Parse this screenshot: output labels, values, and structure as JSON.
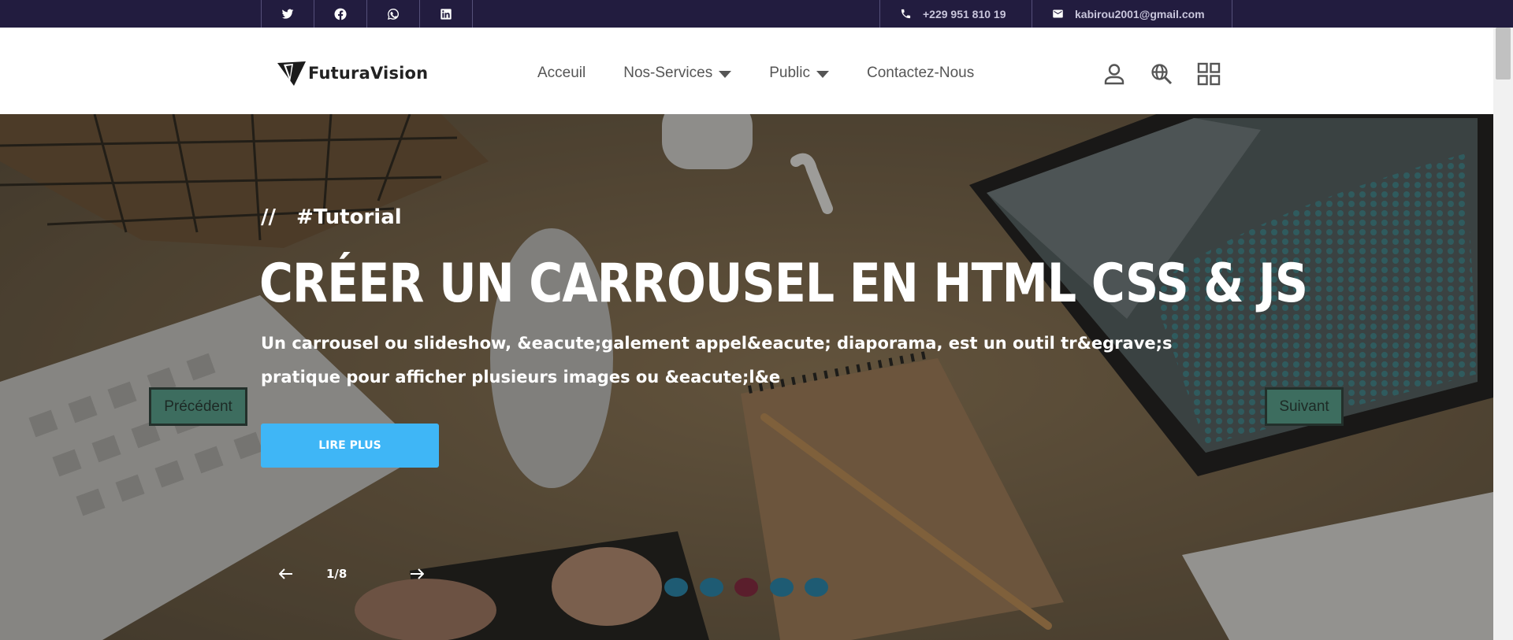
{
  "topbar": {
    "socials": [
      {
        "icon": "twitter-icon"
      },
      {
        "icon": "facebook-icon"
      },
      {
        "icon": "whatsapp-icon"
      },
      {
        "icon": "linkedin-icon"
      }
    ],
    "phone": "+229 951 810 19",
    "email": "kabirou2001@gmail.com"
  },
  "header": {
    "brand": "FuturaVision",
    "nav": [
      {
        "label": "Acceuil",
        "dropdown": false
      },
      {
        "label": "Nos-Services",
        "dropdown": true
      },
      {
        "label": "Public",
        "dropdown": true
      },
      {
        "label": "Contactez-Nous",
        "dropdown": false
      }
    ],
    "icons": [
      "user-icon",
      "search-globe-icon",
      "grid-menu-icon"
    ]
  },
  "hero": {
    "slashes": "//",
    "tag": "#Tutorial",
    "title": "CRÉER UN CARROUSEL EN HTML CSS & JS",
    "description": "Un carrousel ou slideshow, &eacute;galement appel&eacute; diaporama, est un outil tr&egrave;s pratique pour afficher plusieurs images ou &eacute;l&e",
    "read_more": "LIRE PLUS",
    "prev": "Précédent",
    "next": "Suivant",
    "counter": "1/8",
    "dots": [
      {
        "color": "#1e5b73",
        "active": false
      },
      {
        "color": "#1e5b73",
        "active": false
      },
      {
        "color": "#5a1e2c",
        "active": true
      },
      {
        "color": "#1e5b73",
        "active": false
      },
      {
        "color": "#1e5b73",
        "active": false
      }
    ]
  },
  "colors": {
    "topbar_bg": "#221c3f",
    "accent": "#3fb6f6",
    "nav_text": "#555555",
    "control_green": "#3d6d5f"
  }
}
